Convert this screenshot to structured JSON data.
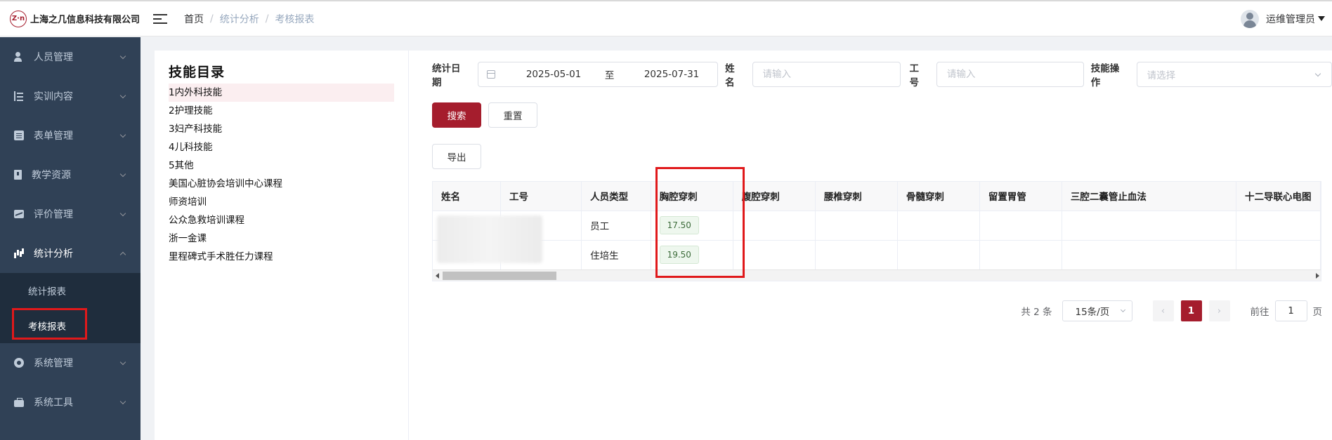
{
  "header": {
    "company": "上海之几信息科技有限公司",
    "logo_mark": "Z·n",
    "breadcrumb": [
      "首页",
      "统计分析",
      "考核报表"
    ],
    "user_name": "运维管理员"
  },
  "sidebar": {
    "items": [
      {
        "label": "人员管理",
        "icon": "user-icon"
      },
      {
        "label": "实训内容",
        "icon": "tree-icon"
      },
      {
        "label": "表单管理",
        "icon": "form-icon"
      },
      {
        "label": "教学资源",
        "icon": "book-icon"
      },
      {
        "label": "评价管理",
        "icon": "evaluation-icon"
      },
      {
        "label": "统计分析",
        "icon": "chart-icon",
        "expanded": true,
        "children": [
          {
            "label": "统计报表"
          },
          {
            "label": "考核报表",
            "active": true
          }
        ]
      },
      {
        "label": "系统管理",
        "icon": "gear-icon"
      },
      {
        "label": "系统工具",
        "icon": "toolbox-icon"
      }
    ]
  },
  "catalog": {
    "title": "技能目录",
    "items": [
      "1内外科技能",
      "2护理技能",
      "3妇产科技能",
      "4儿科技能",
      "5其他",
      "美国心脏协会培训中心课程",
      "师资培训",
      "公众急救培训课程",
      "浙一金课",
      "里程碑式手术胜任力课程"
    ]
  },
  "filters": {
    "date_label": "统计日期",
    "date_start": "2025-05-01",
    "date_sep": "至",
    "date_end": "2025-07-31",
    "name_label": "姓名",
    "name_placeholder": "请输入",
    "id_label": "工号",
    "id_placeholder": "请输入",
    "skill_label": "技能操作",
    "skill_placeholder": "请选择"
  },
  "buttons": {
    "search": "搜索",
    "reset": "重置",
    "export": "导出"
  },
  "table": {
    "columns": [
      "姓名",
      "工号",
      "人员类型",
      "胸腔穿刺",
      "腹腔穿刺",
      "腰椎穿刺",
      "骨髓穿刺",
      "留置胃管",
      "三腔二囊管止血法",
      "十二导联心电图"
    ],
    "rows": [
      {
        "name": "",
        "id": "",
        "type": "员工",
        "scores": [
          "17.50",
          "",
          "",
          "",
          "",
          "",
          ""
        ]
      },
      {
        "name": "",
        "id": "",
        "type": "住培生",
        "scores": [
          "19.50",
          "",
          "",
          "",
          "",
          "",
          ""
        ]
      }
    ]
  },
  "pagination": {
    "total": "共 2 条",
    "page_size": "15条/页",
    "prev": "‹",
    "current": "1",
    "next": "›",
    "goto_label": "前往",
    "goto_value": "1",
    "page_suffix": "页"
  },
  "colors": {
    "accent": "#a51d2d",
    "sidebar_bg": "#304156",
    "highlight": "#e0191b"
  }
}
